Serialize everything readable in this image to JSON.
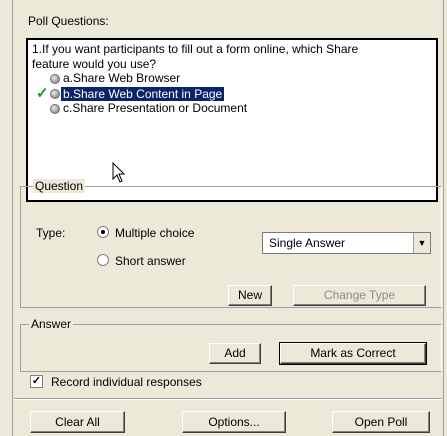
{
  "poll_questions_label": "Poll Questions:",
  "question_text_line1": "1.If you want participants to fill out a form online, which Share",
  "question_text_line2": "feature would you use?",
  "options": [
    {
      "label": "a.Share Web Browser",
      "selected": false,
      "correct": false
    },
    {
      "label": "b.Share Web Content in Page",
      "selected": true,
      "correct": true
    },
    {
      "label": "c.Share Presentation or Document",
      "selected": false,
      "correct": false
    }
  ],
  "question_group": {
    "legend": "Question",
    "type_label": "Type:",
    "multiple_choice_label": "Multiple choice",
    "short_answer_label": "Short answer",
    "answer_mode_value": "Single Answer",
    "new_button": "New",
    "change_type_button": "Change Type"
  },
  "answer_group": {
    "legend": "Answer",
    "add_button": "Add",
    "mark_correct_button": "Mark as Correct"
  },
  "record_checkbox_label": "Record individual responses",
  "record_checked": true,
  "bottom_buttons": {
    "clear_all": "Clear All",
    "options": "Options...",
    "open_poll": "Open Poll"
  },
  "icons": {
    "check": "check-icon",
    "dropdown": "chevron-down-icon",
    "cursor": "mouse-pointer-icon"
  },
  "colors": {
    "selection_bg": "#0a246a",
    "check_green": "#1c9a1c",
    "panel_bg": "#ece9d8"
  }
}
